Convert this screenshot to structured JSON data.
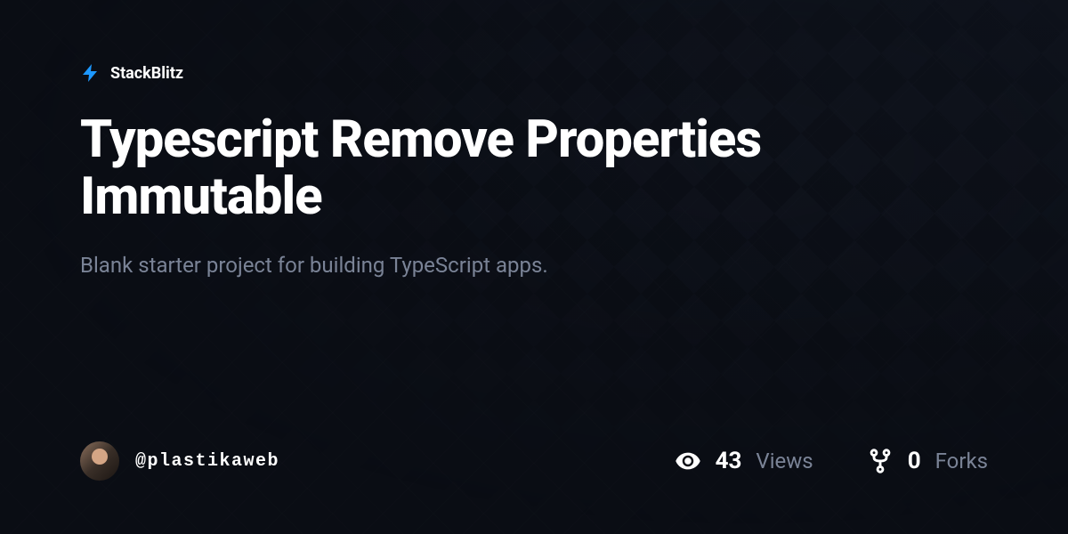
{
  "brand": {
    "name": "StackBlitz"
  },
  "project": {
    "title": "Typescript Remove Properties Immutable",
    "description": "Blank starter project for building TypeScript apps."
  },
  "author": {
    "username": "@plastikaweb"
  },
  "stats": {
    "views": {
      "count": "43",
      "label": "Views"
    },
    "forks": {
      "count": "0",
      "label": "Forks"
    }
  },
  "colors": {
    "accent": "#1d98ff"
  }
}
